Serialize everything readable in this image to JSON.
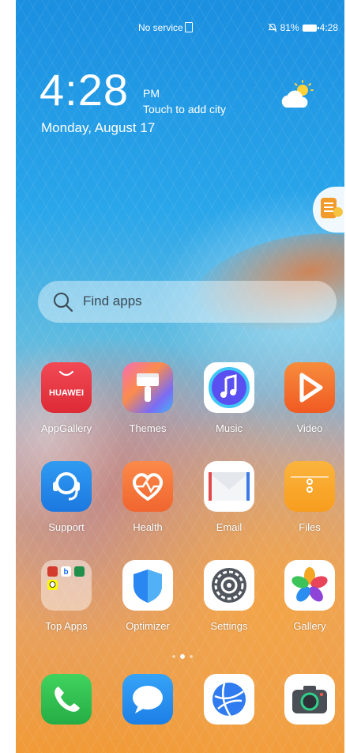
{
  "status_bar": {
    "carrier": "No service",
    "sim_icon": "sim-card-icon",
    "mute_icon": "notifications-off-icon",
    "battery_percent": "81%",
    "battery_icon": "battery-icon",
    "time": "4:28"
  },
  "clock_widget": {
    "time": "4:28",
    "ampm": "PM",
    "city_prompt": "Touch to add city",
    "date": "Monday, August 17",
    "weather_icon": "partly-sunny-icon"
  },
  "side_widget": {
    "icon": "notes-icon"
  },
  "search": {
    "label": "Find apps",
    "icon": "search-icon"
  },
  "apps": [
    {
      "label": "AppGallery",
      "icon": "appgallery-icon",
      "tile_text": "HUAWEI"
    },
    {
      "label": "Themes",
      "icon": "themes-brush-icon"
    },
    {
      "label": "Music",
      "icon": "music-note-icon"
    },
    {
      "label": "Video",
      "icon": "video-play-icon"
    },
    {
      "label": "Support",
      "icon": "support-headset-icon"
    },
    {
      "label": "Health",
      "icon": "health-heart-icon"
    },
    {
      "label": "Email",
      "icon": "email-envelope-icon"
    },
    {
      "label": "Files",
      "icon": "files-folder-icon"
    },
    {
      "label": "Top Apps",
      "icon": "folder-icon"
    },
    {
      "label": "Optimizer",
      "icon": "optimizer-shield-icon"
    },
    {
      "label": "Settings",
      "icon": "settings-gear-icon"
    },
    {
      "label": "Gallery",
      "icon": "gallery-flower-icon"
    }
  ],
  "page_indicator": {
    "pages": 3,
    "current": 2
  },
  "dock": [
    {
      "name": "Phone",
      "icon": "phone-icon"
    },
    {
      "name": "Messaging",
      "icon": "message-bubble-icon"
    },
    {
      "name": "Browser",
      "icon": "browser-globe-icon"
    },
    {
      "name": "Camera",
      "icon": "camera-icon"
    }
  ],
  "colors": {
    "wallpaper_top": "#1b8fe0",
    "wallpaper_bottom": "#f19a37",
    "appgallery": "#e8343f",
    "video": "#f4682b",
    "health": "#f57a3c",
    "phone": "#2fbf4a",
    "messages": "#2a8bf0"
  }
}
